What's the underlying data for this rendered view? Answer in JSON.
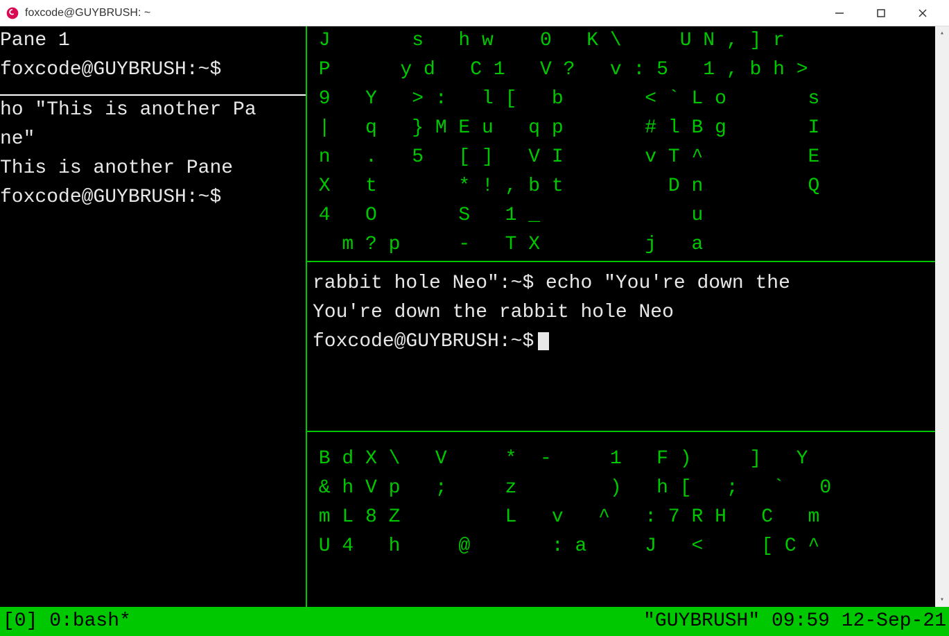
{
  "window": {
    "title": "foxcode@GUYBRUSH: ~"
  },
  "panes": {
    "top_left": "Pane 1\nfoxcode@GUYBRUSH:~$",
    "bottom_left": "ho \"This is another Pa\nne\"\nThis is another Pane\nfoxcode@GUYBRUSH:~$",
    "matrix_top": " J       s   h w    0   K \\     U N , ] r\n P      y d   C 1   V ?   v : 5   1 , b h >\n 9   Y   > :   l [   b       < ` L o       s\n |   q   } M E u   q p       # l B g       I\n n   .   5   [ ]   V I       v T ^         E\n X   t       * ! , b t         D n         Q\n 4   O       S   1 _             u\n   m ? p     -   T X         j   a",
    "middle": {
      "line1": "rabbit hole Neo\":~$ echo \"You're down the",
      "line2": "You're down the rabbit hole Neo",
      "prompt": "foxcode@GUYBRUSH:~$"
    },
    "matrix_bottom": " B d X \\   V     *  -     1   F )     ]   Y\n & h V p   ;     z        )   h [   ;   `   0\n m L 8 Z         L   v   ^   : 7 R H   C   m\n U 4   h     @       : a     J   <     [ C ^"
  },
  "statusbar": {
    "left": "[0] 0:bash*",
    "right": "\"GUYBRUSH\" 09:59 12-Sep-21"
  }
}
